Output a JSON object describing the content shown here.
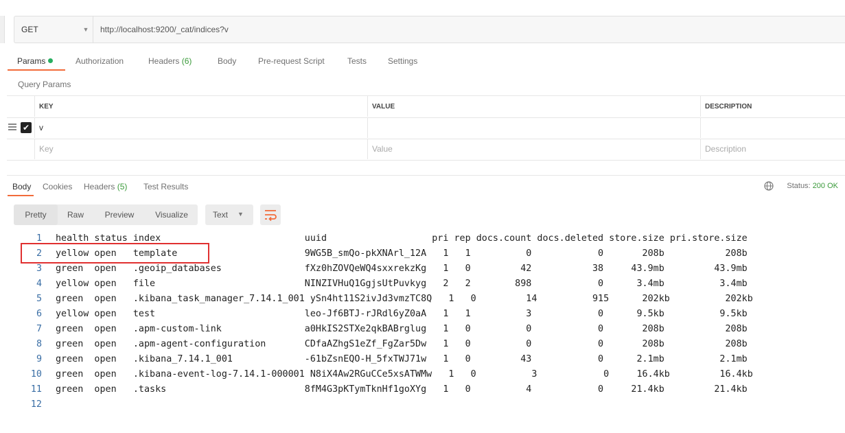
{
  "request": {
    "method": "GET",
    "url": "http://localhost:9200/_cat/indices?v"
  },
  "request_tabs": {
    "params": "Params",
    "authorization": "Authorization",
    "headers": "Headers",
    "headers_count": "(6)",
    "body": "Body",
    "prerequest": "Pre-request Script",
    "tests": "Tests",
    "settings": "Settings"
  },
  "query_params": {
    "title": "Query Params",
    "columns": {
      "key": "KEY",
      "value": "VALUE",
      "description": "DESCRIPTION"
    },
    "rows": [
      {
        "key": "v",
        "value": "",
        "description": "",
        "checked": true
      }
    ],
    "placeholders": {
      "key": "Key",
      "value": "Value",
      "description": "Description"
    }
  },
  "response_tabs": {
    "body": "Body",
    "cookies": "Cookies",
    "headers": "Headers",
    "headers_count": "(5)",
    "test_results": "Test Results"
  },
  "status": {
    "label": "Status:",
    "value": "200 OK"
  },
  "view_modes": {
    "pretty": "Pretty",
    "raw": "Raw",
    "preview": "Preview",
    "visualize": "Visualize"
  },
  "format": {
    "selected": "Text"
  },
  "response_lines": [
    {
      "num": "1",
      "text": "health status index                          uuid                   pri rep docs.count docs.deleted store.size pri.store.size"
    },
    {
      "num": "2",
      "text": "yellow open   template                       9WG5B_smQo-pkXNArl_12A   1   1          0            0       208b           208b"
    },
    {
      "num": "3",
      "text": "green  open   .geoip_databases               fXz0hZOVQeWQ4sxxrekzKg   1   0         42           38     43.9mb         43.9mb"
    },
    {
      "num": "4",
      "text": "yellow open   file                           NINZIVHuQ1GgjsUtPuvkyg   2   2        898            0      3.4mb          3.4mb"
    },
    {
      "num": "5",
      "text": "green  open   .kibana_task_manager_7.14.1_001 ySn4ht11S2ivJd3vmzTC8Q   1   0         14          915      202kb          202kb"
    },
    {
      "num": "6",
      "text": "yellow open   test                           leo-Jf6BTJ-rJRdl6yZ0aA   1   1          3            0      9.5kb          9.5kb"
    },
    {
      "num": "7",
      "text": "green  open   .apm-custom-link               a0HkIS2STXe2qkBABrglug   1   0          0            0       208b           208b"
    },
    {
      "num": "8",
      "text": "green  open   .apm-agent-configuration       CDfaAZhgS1eZf_FgZar5Dw   1   0          0            0       208b           208b"
    },
    {
      "num": "9",
      "text": "green  open   .kibana_7.14.1_001             -61bZsnEQO-H_5fxTWJ71w   1   0         43            0      2.1mb          2.1mb"
    },
    {
      "num": "10",
      "text": "green  open   .kibana-event-log-7.14.1-000001 N8iX4Aw2RGuCCe5xsATWMw   1   0          3            0     16.4kb         16.4kb"
    },
    {
      "num": "11",
      "text": "green  open   .tasks                         8fM4G3pKTymTknHf1goXYg   1   0          4            0     21.4kb         21.4kb"
    },
    {
      "num": "12",
      "text": ""
    }
  ]
}
